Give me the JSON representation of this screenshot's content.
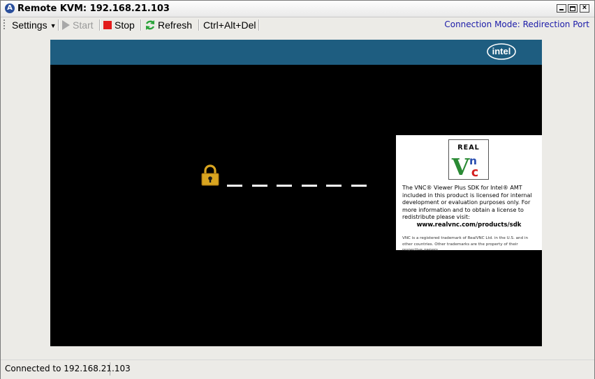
{
  "window": {
    "title": "Remote KVM: 192.168.21.103",
    "app_icon": "A"
  },
  "toolbar": {
    "settings": "Settings",
    "start": "Start",
    "stop": "Stop",
    "refresh": "Refresh",
    "cad": "Ctrl+Alt+Del",
    "connection_mode": "Connection Mode: Redirection Port"
  },
  "remote_screen": {
    "banner_logo": "intel",
    "password_mask_count": 6,
    "vnc_notice": {
      "logo_text": "REAL",
      "body": "The VNC® Viewer Plus SDK for Intel® AMT included in this product is licensed for internal development or evaluation purposes only.  For more information and to obtain a license to redistribute please visit:",
      "url": "www.realvnc.com/products/sdk",
      "footer": "VNC is a registered trademark of RealVNC Ltd. in the U.S. and in other countries. Other trademarks are the property of their respective owners."
    }
  },
  "status": {
    "text": "Connected to 192.168.21.103"
  },
  "colors": {
    "banner": "#1e5d80",
    "mode_text": "#1a1aa8",
    "lock": "#d9a520",
    "stop": "#e21b1b",
    "refresh": "#2aa33a"
  }
}
